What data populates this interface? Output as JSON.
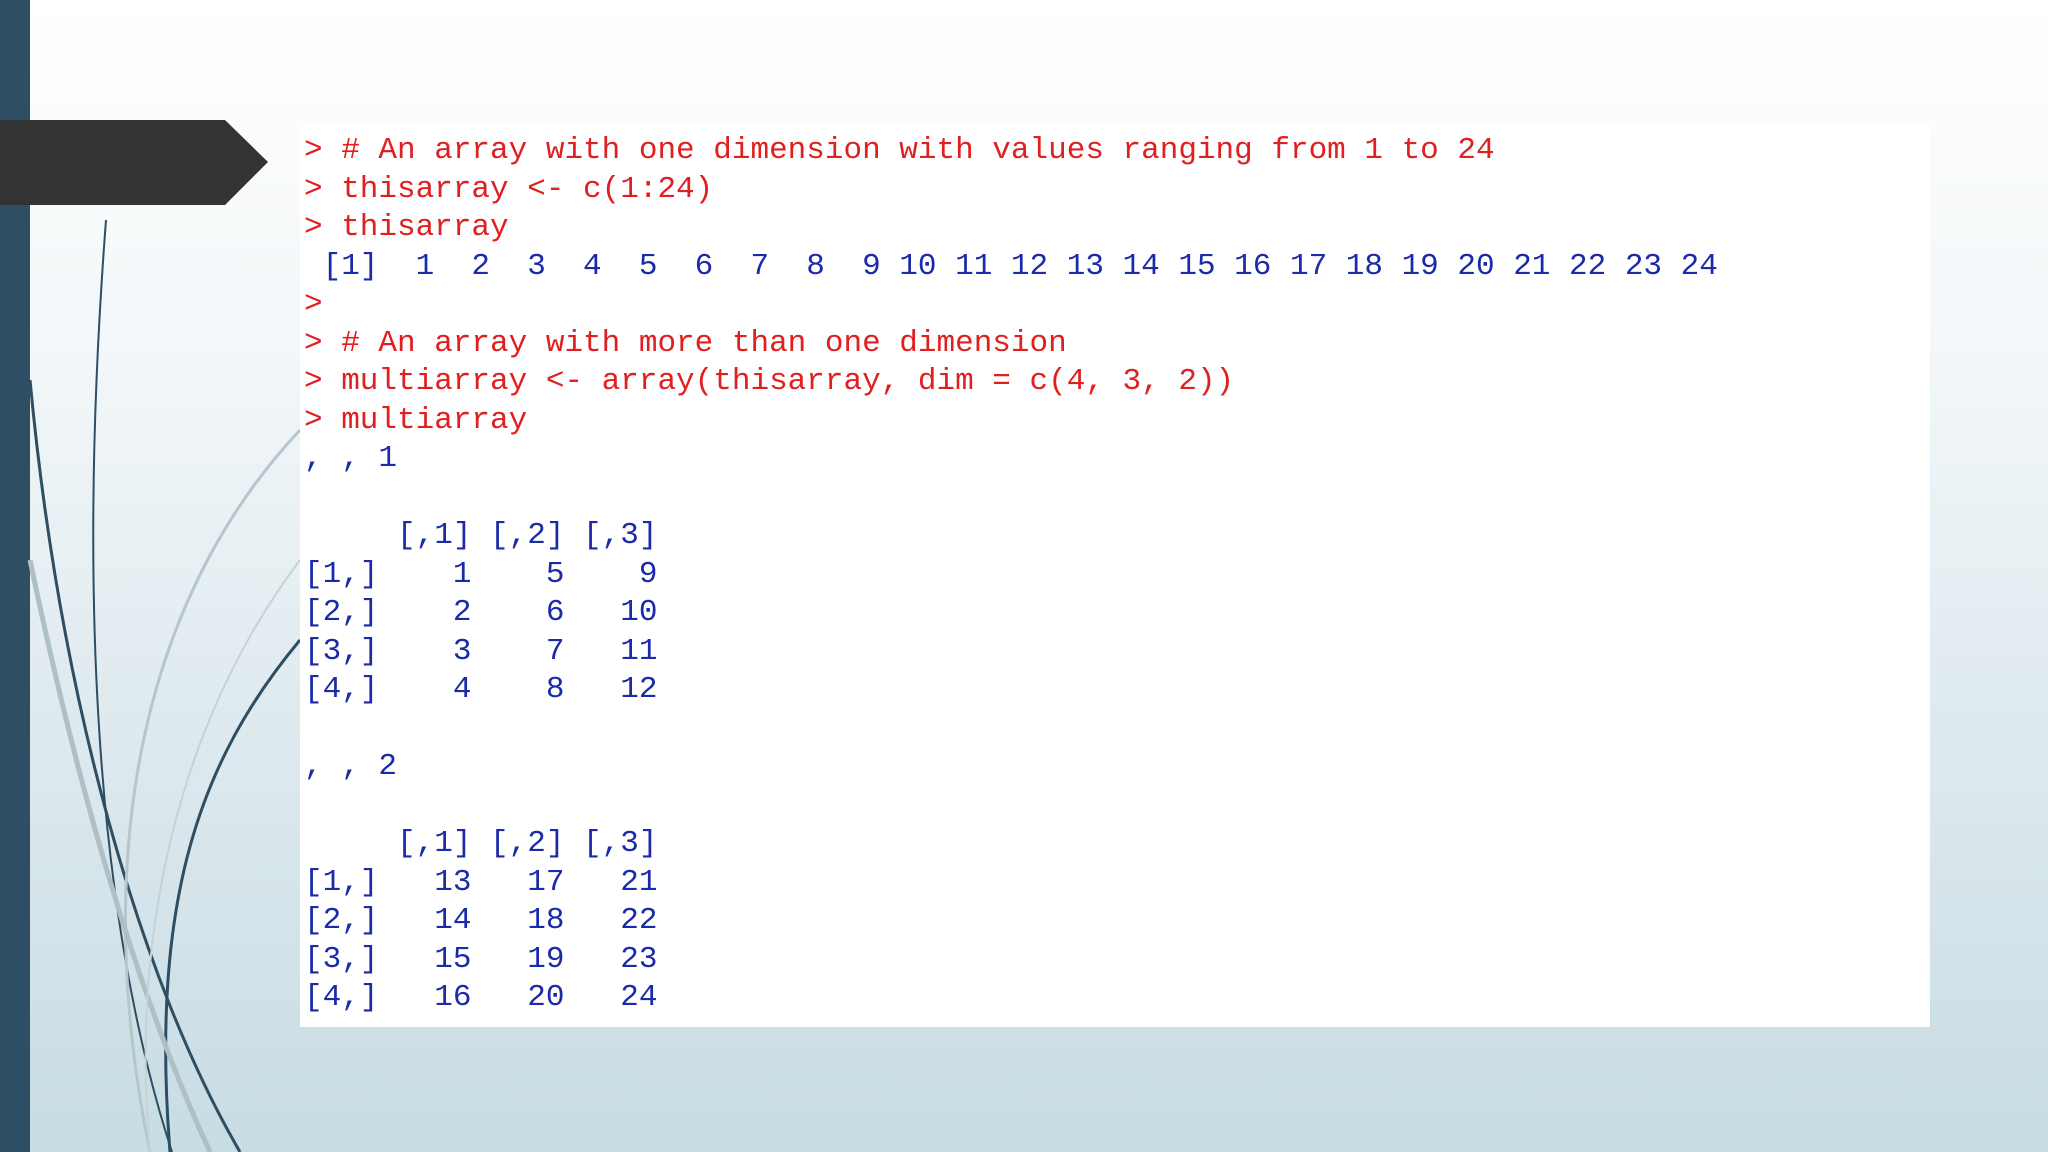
{
  "console": {
    "lines": [
      {
        "kind": "cmd",
        "text": "> # An array with one dimension with values ranging from 1 to 24"
      },
      {
        "kind": "cmd",
        "text": "> thisarray <- c(1:24)"
      },
      {
        "kind": "cmd",
        "text": "> thisarray"
      },
      {
        "kind": "out",
        "text": " [1]  1  2  3  4  5  6  7  8  9 10 11 12 13 14 15 16 17 18 19 20 21 22 23 24"
      },
      {
        "kind": "cmd",
        "text": ">"
      },
      {
        "kind": "cmd",
        "text": "> # An array with more than one dimension"
      },
      {
        "kind": "cmd",
        "text": "> multiarray <- array(thisarray, dim = c(4, 3, 2))"
      },
      {
        "kind": "cmd",
        "text": "> multiarray"
      },
      {
        "kind": "out",
        "text": ", , 1"
      },
      {
        "kind": "out",
        "text": ""
      },
      {
        "kind": "out",
        "text": "     [,1] [,2] [,3]"
      },
      {
        "kind": "out",
        "text": "[1,]    1    5    9"
      },
      {
        "kind": "out",
        "text": "[2,]    2    6   10"
      },
      {
        "kind": "out",
        "text": "[3,]    3    7   11"
      },
      {
        "kind": "out",
        "text": "[4,]    4    8   12"
      },
      {
        "kind": "out",
        "text": ""
      },
      {
        "kind": "out",
        "text": ", , 2"
      },
      {
        "kind": "out",
        "text": ""
      },
      {
        "kind": "out",
        "text": "     [,1] [,2] [,3]"
      },
      {
        "kind": "out",
        "text": "[1,]   13   17   21"
      },
      {
        "kind": "out",
        "text": "[2,]   14   18   22"
      },
      {
        "kind": "out",
        "text": "[3,]   15   19   23"
      },
      {
        "kind": "out",
        "text": "[4,]   16   20   24"
      }
    ]
  },
  "colors": {
    "command": "#e02020",
    "output": "#1a2aa8",
    "sidebar": "#2d4e63",
    "arrow_tab": "#333333"
  }
}
